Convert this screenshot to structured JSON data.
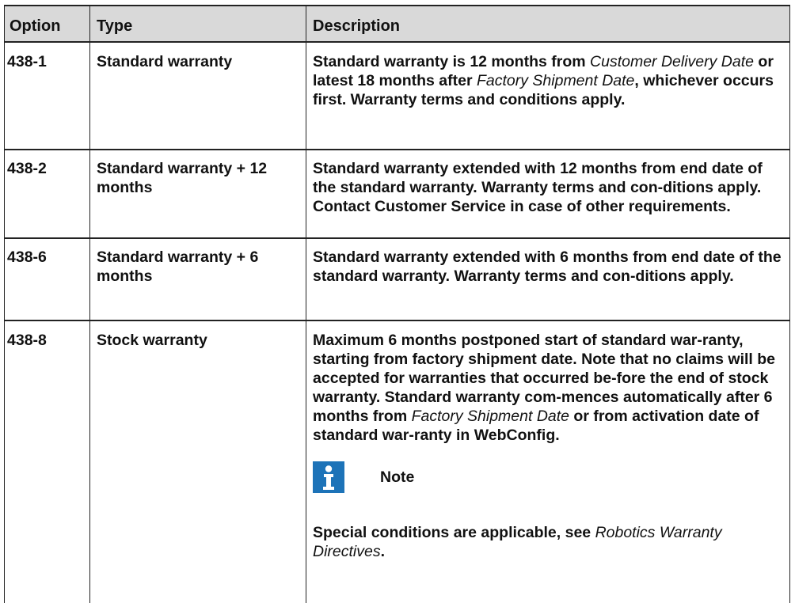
{
  "table": {
    "headers": {
      "option": "Option",
      "type": "Type",
      "description": "Description"
    },
    "rows": [
      {
        "option": "438-1",
        "type": "Standard warranty",
        "desc_parts": [
          "Standard warranty is 12 months from ",
          "Customer Delivery Date",
          " or latest 18 months after ",
          "Factory Shipment Date",
          ", whichever occurs first. Warranty terms and conditions apply."
        ]
      },
      {
        "option": "438-2",
        "type": "Standard warranty + 12 months",
        "description": "Standard warranty extended with 12 months from end date of the standard warranty. Warranty terms and con-ditions apply. Contact Customer Service in case of other requirements."
      },
      {
        "option": "438-6",
        "type": "Standard warranty + 6 months",
        "description": "Standard warranty extended with 6 months from end date of the standard warranty. Warranty terms and con-ditions apply."
      },
      {
        "option": "438-8",
        "type": "Stock warranty",
        "desc_parts": [
          "Maximum 6 months postponed start of standard war-ranty, starting from factory shipment date. Note that no claims will be accepted for warranties that occurred be-fore the end of stock warranty. Standard warranty com-mences automatically after 6 months from ",
          "Factory Shipment Date",
          " or from activation date of standard war-ranty in WebConfig."
        ],
        "note": {
          "icon": "info-icon",
          "title": "Note",
          "text_parts": [
            "Special conditions are applicable, see ",
            "Robotics Warranty Directives",
            "."
          ]
        }
      }
    ]
  },
  "colors": {
    "header_bg": "#d9d9d9",
    "note_icon": "#1d73b8",
    "lines": "#222222"
  }
}
